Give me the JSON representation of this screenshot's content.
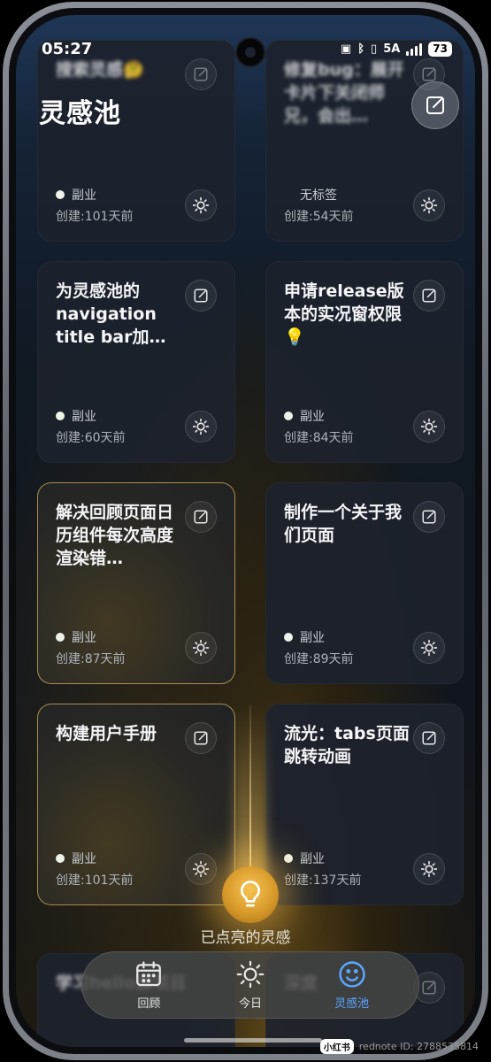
{
  "status_bar": {
    "time": "05:27",
    "network": "5A",
    "battery": "73"
  },
  "header": {
    "title": "灵感池"
  },
  "cards": [
    {
      "title": "搜索灵感🤔",
      "tag": "副业",
      "created": "创建:101天前"
    },
    {
      "title": "修复bug：展开卡片下关闭师兄，会出…",
      "tag": "无标签",
      "created": "创建:54天前"
    },
    {
      "title": "为灵感池的navigation title bar加…",
      "tag": "副业",
      "created": "创建:60天前"
    },
    {
      "title": "申请release版本的实况窗权限💡",
      "tag": "副业",
      "created": "创建:84天前"
    },
    {
      "title": "解决回顾页面日历组件每次高度渲染错…",
      "tag": "副业",
      "created": "创建:87天前"
    },
    {
      "title": "制作一个关于我们页面",
      "tag": "副业",
      "created": "创建:89天前"
    },
    {
      "title": "构建用户手册",
      "tag": "副业",
      "created": "创建:101天前"
    },
    {
      "title": "流光：tabs页面跳转动画",
      "tag": "副业",
      "created": "创建:137天前"
    },
    {
      "title": "学习hello源项目",
      "tag": "",
      "created": ""
    },
    {
      "title": "深度",
      "tag": "",
      "created": ""
    }
  ],
  "lit_label": "已点亮的灵感",
  "tabs": [
    {
      "label": "回顾",
      "icon": "calendar-icon"
    },
    {
      "label": "今日",
      "icon": "sun-icon"
    },
    {
      "label": "灵感池",
      "icon": "smile-icon"
    }
  ],
  "watermark": {
    "logo": "小红书",
    "text": "rednote ID: 2788535814"
  },
  "colors": {
    "accent": "#5aa6ff",
    "glow": "#f0b446",
    "lit_border": "#d6b260"
  }
}
